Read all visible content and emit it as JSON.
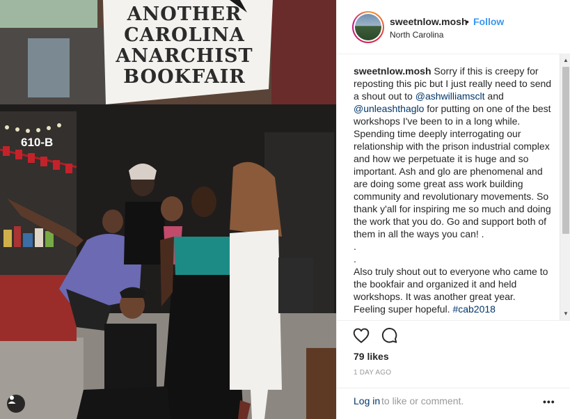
{
  "photo": {
    "banner_lines": [
      "ANOTHER",
      "CAROLINA",
      "ANARCHIST",
      "BOOKFAIR"
    ],
    "address_sign": "610-B",
    "user_tag_icon": "person-tag-icon"
  },
  "post": {
    "username": "sweetnlow.mosh",
    "separator": "•",
    "follow_label": "Follow",
    "location": "North Carolina",
    "caption": {
      "username": "sweetnlow.mosh",
      "part1": " Sorry if this is creepy for reposting this pic but I just really need to send a shout out to ",
      "mention1": "@ashwilliamsclt",
      "part2": " and ",
      "mention2": "@unleashthaglo",
      "part3": " for putting on one of the best workshops I've been to in a long while. Spending time deeply interrogating our relationship with the prison industrial complex and how we perpetuate it is huge and so important. Ash and glo are phenomenal and are doing some great ass work building community and revolutionary movements. So thank y'all for inspiring me so much and doing the work that you do. Go and support both of them in all the ways you can! .",
      "dot1": ".",
      "dot2": ".",
      "part4": "Also truly shout out to everyone who came to the bookfair and organized it and held workshops. It was another great year.",
      "part5": "Feeling super hopeful. ",
      "hashtag": "#cab2018"
    },
    "likes": "79 likes",
    "time": "1 DAY AGO",
    "login_link": "Log in",
    "login_rest": " to like or comment.",
    "more_label": "•••"
  },
  "icons": {
    "like": "heart-icon",
    "comment": "comment-bubble-icon",
    "more": "more-options-icon"
  },
  "colors": {
    "link": "#3897f0",
    "mention": "#003569",
    "muted": "#999999",
    "text": "#262626"
  }
}
